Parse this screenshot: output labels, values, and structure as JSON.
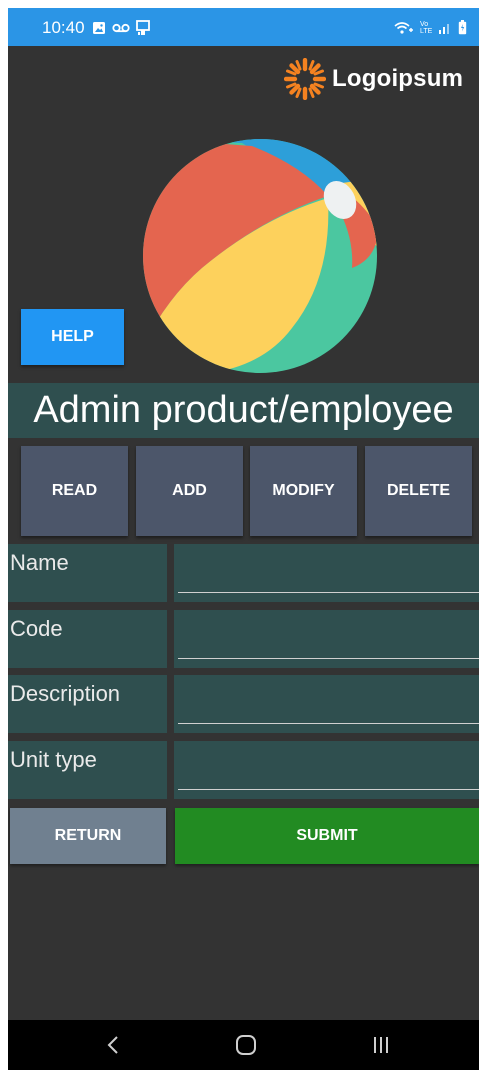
{
  "status_bar": {
    "time": "10:40",
    "left_icons": [
      "image-icon",
      "voicemail-icon",
      "screen-cast-icon"
    ],
    "right_icons": [
      "wifi-calling-icon",
      "volte-icon",
      "signal-icon",
      "battery-icon"
    ],
    "volte_text": "Vo LTE"
  },
  "logo": {
    "text": "Logoipsum",
    "color": "#f58220"
  },
  "header": {
    "help_label": "HELP",
    "title": "Admin product/employee"
  },
  "actions": {
    "read": "READ",
    "add": "ADD",
    "modify": "MODIFY",
    "delete": "DELETE"
  },
  "form": {
    "fields": [
      {
        "label": "Name",
        "value": ""
      },
      {
        "label": "Code",
        "value": ""
      },
      {
        "label": "Description",
        "value": ""
      },
      {
        "label": "Unit type",
        "value": ""
      }
    ]
  },
  "footer": {
    "return_label": "RETURN",
    "submit_label": "SUBMIT"
  },
  "nav": {
    "back": "back-icon",
    "home": "home-icon",
    "recents": "recents-icon"
  },
  "colors": {
    "background": "#333333",
    "status_bar": "#2b95e6",
    "help_button": "#2196f3",
    "panel": "#2f4f4f",
    "action_button": "#4c566a",
    "return_button": "#708090",
    "submit_button": "#228b22"
  }
}
